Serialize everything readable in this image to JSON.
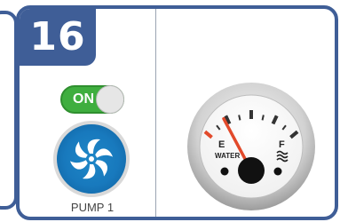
{
  "card": {
    "number": "16"
  },
  "pump": {
    "toggle_label": "ON",
    "label": "PUMP 1"
  },
  "gauge": {
    "empty_label": "E",
    "full_label": "F",
    "center_label": "WATER",
    "level_fraction": 0.22,
    "colors": {
      "needle": "#e24a2b",
      "empty_tick": "#e24a2b",
      "bezel": "#cfcfcf",
      "face": "#ffffff"
    }
  },
  "colors": {
    "accent": "#3f5e97",
    "toggle_on": "#3fae3f",
    "pump_blue": "#1879bd"
  },
  "icons": {
    "pump": "fan-icon",
    "full": "water-waves-icon"
  }
}
